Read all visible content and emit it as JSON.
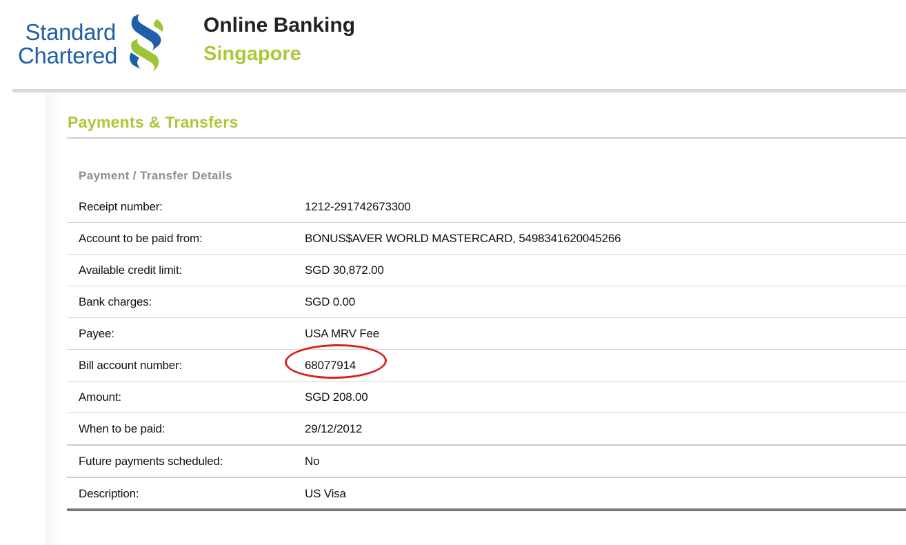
{
  "colors": {
    "brand_blue": "#1f5ea8",
    "brand_green": "#9dc53a",
    "accent_green": "#a9c838",
    "highlight_red": "#d3241c"
  },
  "header": {
    "logo_line1": "Standard",
    "logo_line2": "Chartered",
    "logo_icon": "standard-chartered-logo-icon",
    "title": "Online Banking",
    "subtitle": "Singapore"
  },
  "section": {
    "title": "Payments & Transfers",
    "subtitle": "Payment / Transfer Details"
  },
  "details": [
    {
      "label": "Receipt number:",
      "value": "1212-291742673300"
    },
    {
      "label": "Account to be paid from:",
      "value": "BONUS$AVER WORLD MASTERCARD, 5498341620045266"
    },
    {
      "label": "Available credit limit:",
      "value": "SGD  30,872.00"
    },
    {
      "label": "Bank charges:",
      "value": "SGD 0.00"
    },
    {
      "label": "Payee:",
      "value": "USA MRV Fee"
    },
    {
      "label": "Bill account number:",
      "value": "68077914"
    },
    {
      "label": "Amount:",
      "value": "SGD  208.00"
    },
    {
      "label": "When to be paid:",
      "value": "29/12/2012"
    },
    {
      "label": "Future payments scheduled:",
      "value": "No"
    },
    {
      "label": "Description:",
      "value": "US Visa"
    }
  ]
}
